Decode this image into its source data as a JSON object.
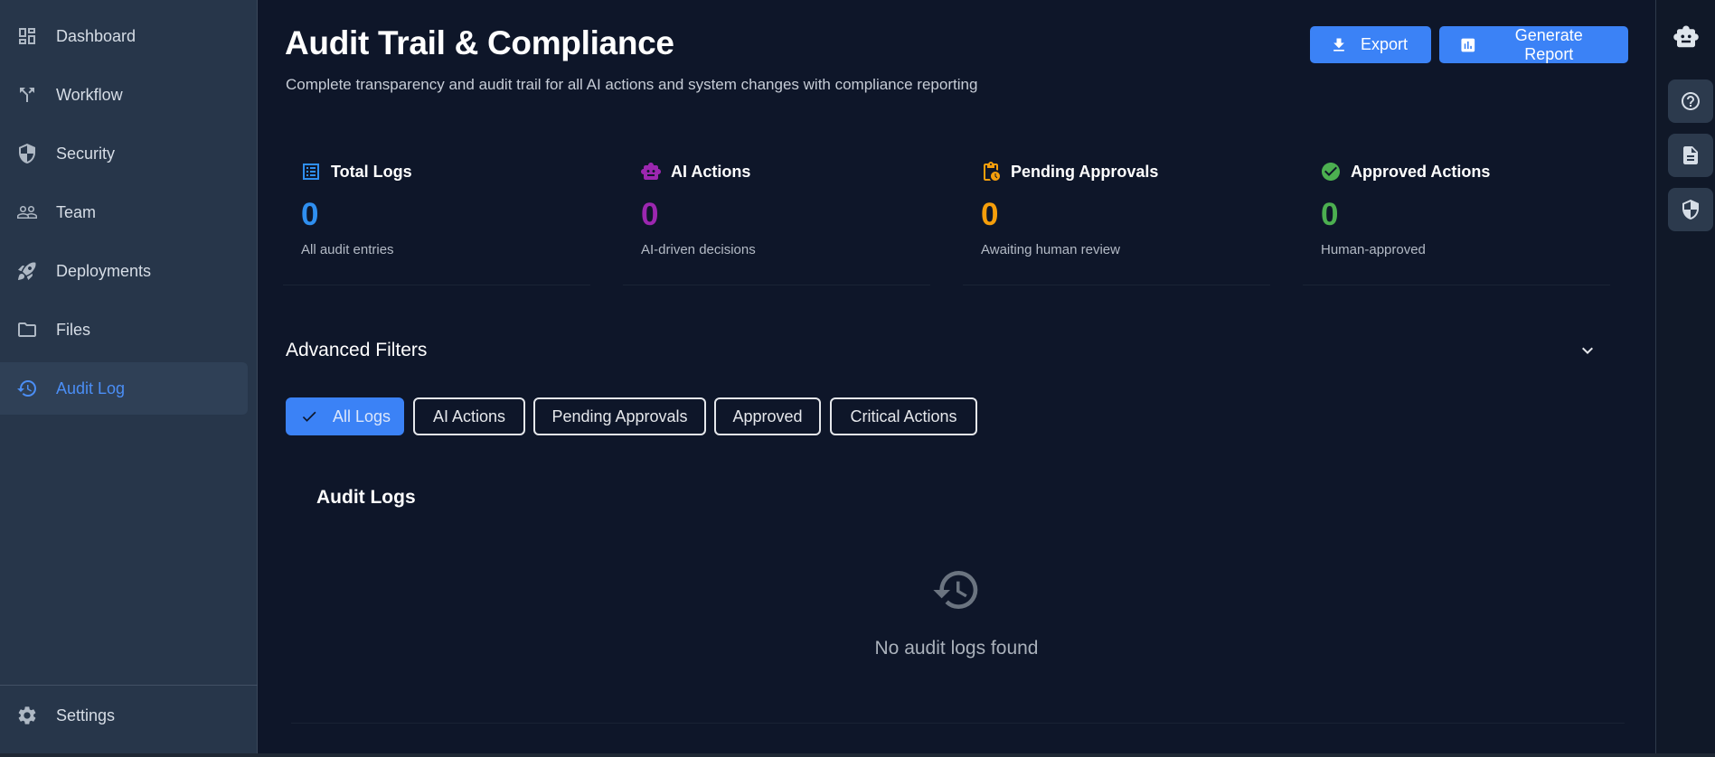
{
  "sidebar": {
    "items": [
      {
        "label": "Dashboard",
        "icon": "dashboard-icon"
      },
      {
        "label": "Workflow",
        "icon": "workflow-icon"
      },
      {
        "label": "Security",
        "icon": "shield-icon"
      },
      {
        "label": "Team",
        "icon": "people-icon"
      },
      {
        "label": "Deployments",
        "icon": "rocket-icon"
      },
      {
        "label": "Files",
        "icon": "folder-icon"
      },
      {
        "label": "Audit Log",
        "icon": "history-icon",
        "active": true
      }
    ],
    "settings_label": "Settings"
  },
  "header": {
    "title": "Audit Trail & Compliance",
    "subtitle": "Complete transparency and audit trail for all AI actions and system changes with compliance reporting",
    "export_label": "Export",
    "report_label": "Generate Report"
  },
  "stats": [
    {
      "title": "Total Logs",
      "value": "0",
      "desc": "All audit entries",
      "color": "#2f8ff0",
      "icon": "list-icon"
    },
    {
      "title": "AI Actions",
      "value": "0",
      "desc": "AI-driven decisions",
      "color": "#9c27b0",
      "icon": "robot-icon"
    },
    {
      "title": "Pending Approvals",
      "value": "0",
      "desc": "Awaiting human review",
      "color": "#f59e0b",
      "icon": "pending-clipboard-icon"
    },
    {
      "title": "Approved Actions",
      "value": "0",
      "desc": "Human-approved",
      "color": "#4caf50",
      "icon": "check-circle-icon"
    }
  ],
  "filters": {
    "title": "Advanced Filters",
    "chips": [
      {
        "label": "All Logs",
        "active": true
      },
      {
        "label": "AI Actions"
      },
      {
        "label": "Pending Approvals"
      },
      {
        "label": "Approved"
      },
      {
        "label": "Critical Actions"
      }
    ]
  },
  "logs": {
    "title": "Audit Logs",
    "empty_text": "No audit logs found"
  },
  "rail": {
    "icons": [
      "robot-icon",
      "help-icon",
      "document-icon",
      "shield-icon"
    ]
  },
  "colors": {
    "accent": "#3b82f6",
    "background": "#0e1629",
    "sidebar": "#27364a"
  }
}
